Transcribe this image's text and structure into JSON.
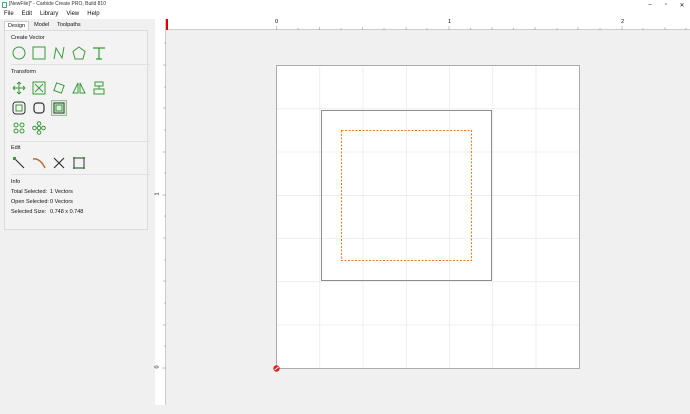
{
  "window": {
    "title": "[NewFile]* - Carbide Create PRO, Build 810",
    "controls": {
      "minimize": "–",
      "maximize": "▫",
      "close": "✕"
    }
  },
  "menu": [
    "File",
    "Edit",
    "Library",
    "View",
    "Help"
  ],
  "tabs": [
    {
      "label": "Design",
      "active": true
    },
    {
      "label": "Model",
      "active": false
    },
    {
      "label": "Toolpaths",
      "active": false
    }
  ],
  "sections": {
    "create_vector": "Create Vector",
    "transform": "Transform",
    "edit": "Edit",
    "info": "Info"
  },
  "create_vector_tools": [
    "circle-icon",
    "rectangle-icon",
    "polyline-icon",
    "polygon-icon",
    "text-icon"
  ],
  "transform_tools_row1": [
    "move-icon",
    "scale-icon",
    "rotate-icon",
    "mirror-icon",
    "align-icon"
  ],
  "transform_tools_row2": [
    "offset-icon",
    "fillet-icon",
    "boolean-icon"
  ],
  "transform_tools_row3": [
    "circular-array-icon",
    "rectangular-array-icon"
  ],
  "edit_tools": [
    "node-edit-icon",
    "curve-edit-icon",
    "trim-icon",
    "bounding-box-icon"
  ],
  "info": {
    "total_selected_label": "Total Selected:",
    "total_selected_value": "1 Vectors",
    "open_selected_label": "Open Selected:",
    "open_selected_value": "0 Vectors",
    "selected_size_label": "Selected Size:",
    "selected_size_value": "0.748 x 0.748"
  },
  "ruler_top_labels": [
    "0",
    "1",
    "2"
  ],
  "ruler_left_labels": [
    "1",
    "0"
  ],
  "colors": {
    "tool_green": "#3a9a3a",
    "selection_orange": "#ff7a1a",
    "origin_red": "#e02020"
  }
}
